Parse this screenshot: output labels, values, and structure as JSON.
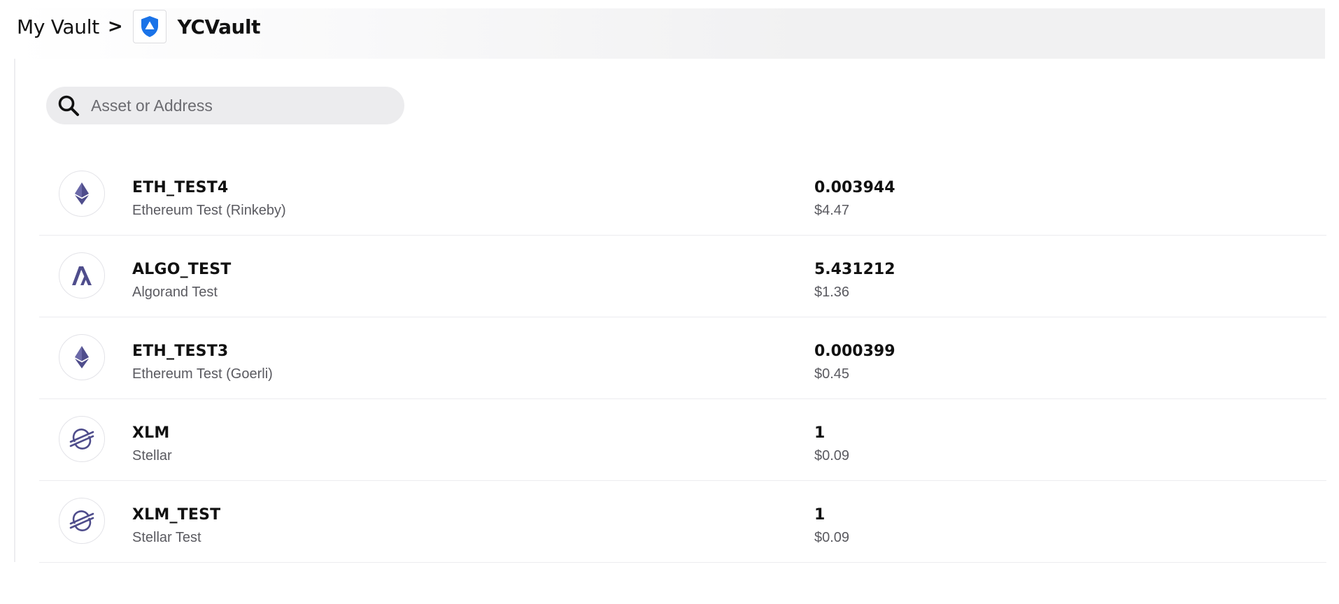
{
  "breadcrumb": {
    "root": "My Vault",
    "separator": ">",
    "vault_icon": "shield-icon",
    "vault_name": "YCVault"
  },
  "search": {
    "icon": "search-icon",
    "value": "",
    "placeholder": "Asset or Address"
  },
  "assets": [
    {
      "symbol": "ETH_TEST4",
      "name": "Ethereum Test (Rinkeby)",
      "balance": "0.003944",
      "usd": "$4.47",
      "icon": "ethereum-icon"
    },
    {
      "symbol": "ALGO_TEST",
      "name": "Algorand Test",
      "balance": "5.431212",
      "usd": "$1.36",
      "icon": "algorand-icon"
    },
    {
      "symbol": "ETH_TEST3",
      "name": "Ethereum Test (Goerli)",
      "balance": "0.000399",
      "usd": "$0.45",
      "icon": "ethereum-icon"
    },
    {
      "symbol": "XLM",
      "name": "Stellar",
      "balance": "1",
      "usd": "$0.09",
      "icon": "stellar-icon"
    },
    {
      "symbol": "XLM_TEST",
      "name": "Stellar Test",
      "balance": "1",
      "usd": "$0.09",
      "icon": "stellar-icon"
    }
  ],
  "colors": {
    "vault_badge": "#1a73e8",
    "coin_icon": "#4f4d8c",
    "text_primary": "#111111",
    "text_secondary": "#5a5a60",
    "search_bg": "#ececee"
  }
}
